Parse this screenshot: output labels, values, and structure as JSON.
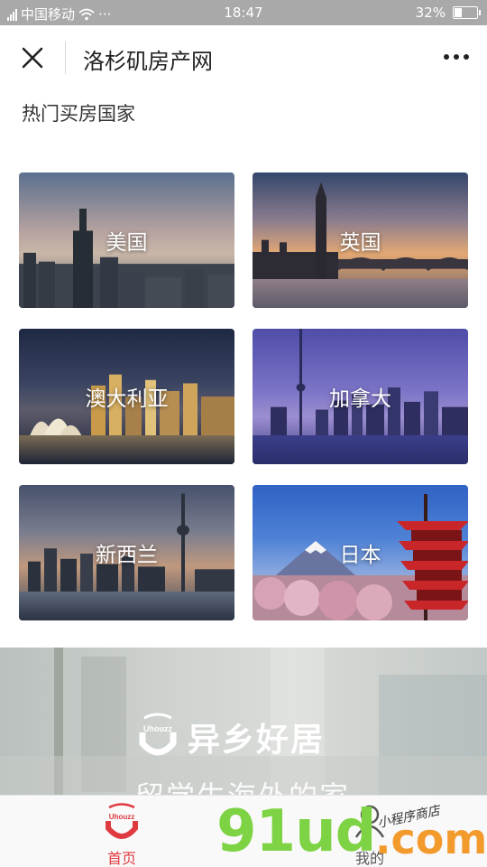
{
  "status_bar": {
    "carrier": "中国移动",
    "dots": "···",
    "time": "18:47",
    "battery": "32%",
    "battery_level": 0.32
  },
  "nav": {
    "title": "洛杉矶房产网"
  },
  "section_title": "热门买房国家",
  "countries": [
    {
      "name": "美国"
    },
    {
      "name": "英国"
    },
    {
      "name": "澳大利亚"
    },
    {
      "name": "加拿大"
    },
    {
      "name": "新西兰"
    },
    {
      "name": "日本"
    }
  ],
  "banner": {
    "logo_mark_text": "Uhouzz",
    "logo_text": "异乡好居",
    "tagline": "留学生海外的家"
  },
  "tabbar": {
    "home_label": "首页",
    "home_logo_text": "Uhouzz",
    "mine_label": "我的",
    "active_color": "#e03a41"
  },
  "watermark": {
    "text": "91ud",
    "suffix": ".com",
    "script": "小程序商店"
  }
}
